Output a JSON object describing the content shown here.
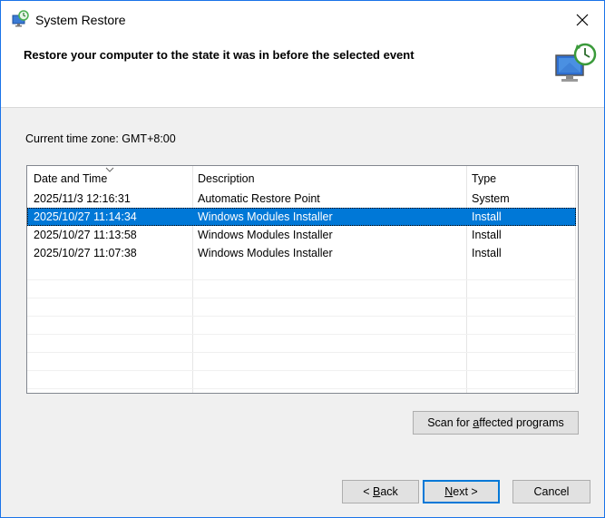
{
  "window": {
    "title": "System Restore",
    "close_symbol": "✕"
  },
  "header": {
    "heading": "Restore your computer to the state it was in before the selected event",
    "icon": "system-restore-monitor-icon"
  },
  "timezone": "Current time zone: GMT+8:00",
  "table": {
    "columns": [
      "Date and Time",
      "Description",
      "Type"
    ],
    "sort_icon": "sort-indicator-icon",
    "rows": [
      {
        "date": "2025/11/3 12:16:31",
        "description": "Automatic Restore Point",
        "type": "System",
        "selected": false
      },
      {
        "date": "2025/10/27 11:14:34",
        "description": "Windows Modules Installer",
        "type": "Install",
        "selected": true
      },
      {
        "date": "2025/10/27 11:13:58",
        "description": "Windows Modules Installer",
        "type": "Install",
        "selected": false
      },
      {
        "date": "2025/10/27 11:07:38",
        "description": "Windows Modules Installer",
        "type": "Install",
        "selected": false
      }
    ]
  },
  "buttons": {
    "scan": {
      "pre": "Scan for ",
      "accel": "a",
      "post": "ffected programs"
    },
    "back": {
      "pre": "< ",
      "accel": "B",
      "post": "ack"
    },
    "next": {
      "pre": "",
      "accel": "N",
      "post": "ext >"
    },
    "cancel": "Cancel"
  },
  "colors": {
    "selection": "#0078d7",
    "window_border": "#1a73e8",
    "dialog_background": "#f0f0f0"
  }
}
